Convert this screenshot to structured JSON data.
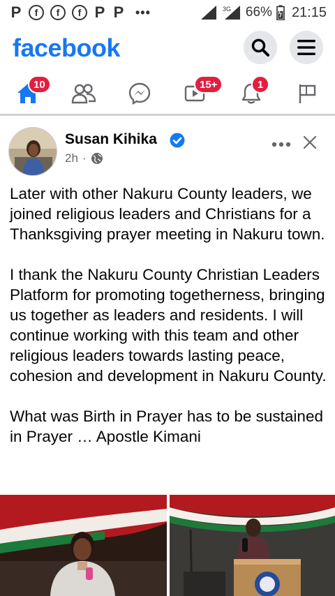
{
  "status_bar": {
    "left_icons": [
      "P",
      "f",
      "f",
      "f",
      "P",
      "P"
    ],
    "overflow": "•••",
    "network": "3G",
    "battery": "66%",
    "time": "21:15"
  },
  "header": {
    "logo": "facebook",
    "search_icon": "search-icon",
    "menu_icon": "hamburger-menu-icon"
  },
  "nav": {
    "home_badge": "10",
    "watch_badge": "15+",
    "notifications_badge": "1"
  },
  "post": {
    "author": "Susan Kihika",
    "time": "2h",
    "separator": "·",
    "paragraph1": "Later with other Nakuru County leaders, we joined religious leaders and Christians for a Thanksgiving prayer meeting in Nakuru town.",
    "paragraph2": "I thank the Nakuru County Christian Leaders Platform for promoting togetherness, bringing us together as leaders and residents. I will continue working with this team and other religious leaders towards lasting peace, cohesion and development in Nakuru County.",
    "paragraph3": "What was Birth in Prayer has to be sustained in Prayer … Apostle Kimani"
  },
  "colors": {
    "brand": "#1877f2",
    "badge": "#e41e3f",
    "muted": "#65676b"
  }
}
